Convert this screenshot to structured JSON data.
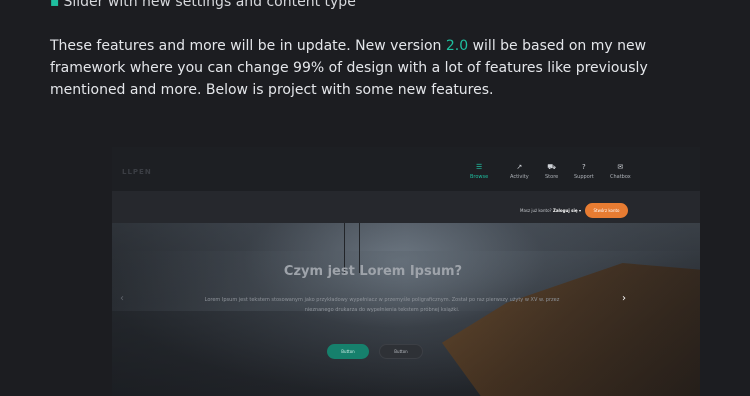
{
  "intro": {
    "bullet_text": "Slider with new settings and content type",
    "paragraph_before_version": "These features and more will be in update. New version ",
    "version": "2.0",
    "paragraph_after_version": " will be based on my new framework where you can change 99% of design with a lot of features like previously mentioned and more. Below is project with some new features."
  },
  "colors": {
    "accent": "#1fbf9f",
    "cta": "#e77c32",
    "background": "#1c1d21"
  },
  "preview": {
    "logo": "LLPEN",
    "nav": [
      {
        "label": "Browse",
        "icon": "list-icon",
        "glyph": "☰",
        "active": true
      },
      {
        "label": "Activity",
        "icon": "activity-icon",
        "glyph": "↗",
        "active": false
      },
      {
        "label": "Store",
        "icon": "cart-icon",
        "glyph": "⛟",
        "active": false
      },
      {
        "label": "Support",
        "icon": "help-icon",
        "glyph": "?",
        "active": false
      },
      {
        "label": "Chatbox",
        "icon": "chat-icon",
        "glyph": "✉",
        "active": false
      }
    ],
    "account_question": "Masz już konto?",
    "login_label": "Zaloguj się ▾",
    "cta_label": "Stwórz konto",
    "hero_title": "Czym jest Lorem Ipsum?",
    "hero_text": "Lorem Ipsum jest tekstem stosowanym jako przykładowy wypełniacz w przemyśle poligraficznym. Został po raz pierwszy użyty w XV w. przez nieznanego drukarza do wypełnienia tekstem próbnej książki.",
    "arrow_prev": "‹",
    "arrow_next": "›",
    "button_primary": "Button",
    "button_secondary": "Button"
  }
}
